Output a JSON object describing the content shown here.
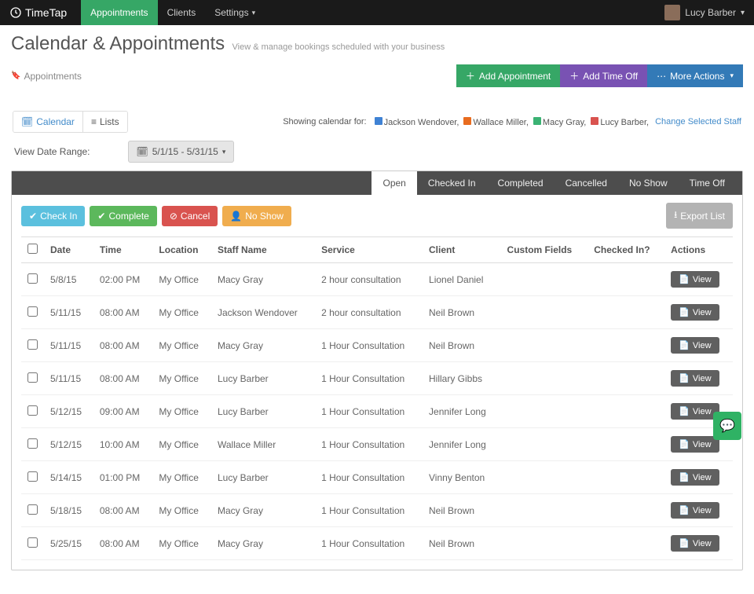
{
  "brand": "TimeTap",
  "nav": [
    {
      "label": "Appointments",
      "active": true
    },
    {
      "label": "Clients",
      "active": false
    },
    {
      "label": "Settings",
      "active": false,
      "caret": true
    }
  ],
  "user": {
    "name": "Lucy Barber"
  },
  "page": {
    "title": "Calendar & Appointments",
    "subtitle": "View & manage bookings scheduled with your business",
    "breadcrumb": "Appointments"
  },
  "header_actions": {
    "add_appointment": "Add Appointment",
    "add_time_off": "Add Time Off",
    "more_actions": "More Actions"
  },
  "view_tabs": {
    "calendar": "Calendar",
    "lists": "Lists"
  },
  "legend": {
    "prefix": "Showing calendar for:",
    "staff": [
      {
        "name": "Jackson Wendover",
        "color": "#3f82d4"
      },
      {
        "name": "Wallace Miller",
        "color": "#e86c1f"
      },
      {
        "name": "Macy Gray",
        "color": "#3bb273"
      },
      {
        "name": "Lucy Barber",
        "color": "#d9534f"
      }
    ],
    "change_link": "Change Selected Staff"
  },
  "date_range": {
    "label": "View Date Range:",
    "value": "5/1/15 - 5/31/15"
  },
  "status_tabs": [
    "Open",
    "Checked In",
    "Completed",
    "Cancelled",
    "No Show",
    "Time Off"
  ],
  "status_active": "Open",
  "toolbar": {
    "checkin": "Check In",
    "complete": "Complete",
    "cancel": "Cancel",
    "noshow": "No Show",
    "export": "Export List"
  },
  "columns": [
    "Date",
    "Time",
    "Location",
    "Staff Name",
    "Service",
    "Client",
    "Custom Fields",
    "Checked In?",
    "Actions"
  ],
  "view_label": "View",
  "rows": [
    {
      "date": "5/8/15",
      "time": "02:00 PM",
      "location": "My Office",
      "staff": "Macy Gray",
      "service": "2 hour consultation",
      "client": "Lionel Daniel",
      "custom": "",
      "checked": ""
    },
    {
      "date": "5/11/15",
      "time": "08:00 AM",
      "location": "My Office",
      "staff": "Jackson Wendover",
      "service": "2 hour consultation",
      "client": "Neil Brown",
      "custom": "",
      "checked": ""
    },
    {
      "date": "5/11/15",
      "time": "08:00 AM",
      "location": "My Office",
      "staff": "Macy Gray",
      "service": "1 Hour Consultation",
      "client": "Neil Brown",
      "custom": "",
      "checked": ""
    },
    {
      "date": "5/11/15",
      "time": "08:00 AM",
      "location": "My Office",
      "staff": "Lucy Barber",
      "service": "1 Hour Consultation",
      "client": "Hillary Gibbs",
      "custom": "",
      "checked": ""
    },
    {
      "date": "5/12/15",
      "time": "09:00 AM",
      "location": "My Office",
      "staff": "Lucy Barber",
      "service": "1 Hour Consultation",
      "client": "Jennifer Long",
      "custom": "",
      "checked": ""
    },
    {
      "date": "5/12/15",
      "time": "10:00 AM",
      "location": "My Office",
      "staff": "Wallace Miller",
      "service": "1 Hour Consultation",
      "client": "Jennifer Long",
      "custom": "",
      "checked": ""
    },
    {
      "date": "5/14/15",
      "time": "01:00 PM",
      "location": "My Office",
      "staff": "Lucy Barber",
      "service": "1 Hour Consultation",
      "client": "Vinny Benton",
      "custom": "",
      "checked": ""
    },
    {
      "date": "5/18/15",
      "time": "08:00 AM",
      "location": "My Office",
      "staff": "Macy Gray",
      "service": "1 Hour Consultation",
      "client": "Neil Brown",
      "custom": "",
      "checked": ""
    },
    {
      "date": "5/25/15",
      "time": "08:00 AM",
      "location": "My Office",
      "staff": "Macy Gray",
      "service": "1 Hour Consultation",
      "client": "Neil Brown",
      "custom": "",
      "checked": ""
    }
  ]
}
